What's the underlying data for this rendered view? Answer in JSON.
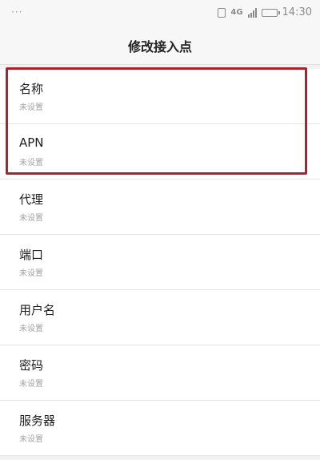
{
  "status_bar": {
    "left_indicator": "···",
    "network": "4G",
    "time": "14:30",
    "icons": [
      "vibrate-icon",
      "network-4g-icon",
      "signal-icon",
      "battery-icon"
    ]
  },
  "header": {
    "title": "修改接入点"
  },
  "settings": [
    {
      "label": "名称",
      "value": "未设置"
    },
    {
      "label": "APN",
      "value": "未设置"
    },
    {
      "label": "代理",
      "value": "未设置"
    },
    {
      "label": "端口",
      "value": "未设置"
    },
    {
      "label": "用户名",
      "value": "未设置"
    },
    {
      "label": "密码",
      "value": "未设置"
    },
    {
      "label": "服务器",
      "value": "未设置"
    }
  ],
  "highlight_color": "#b0202c"
}
